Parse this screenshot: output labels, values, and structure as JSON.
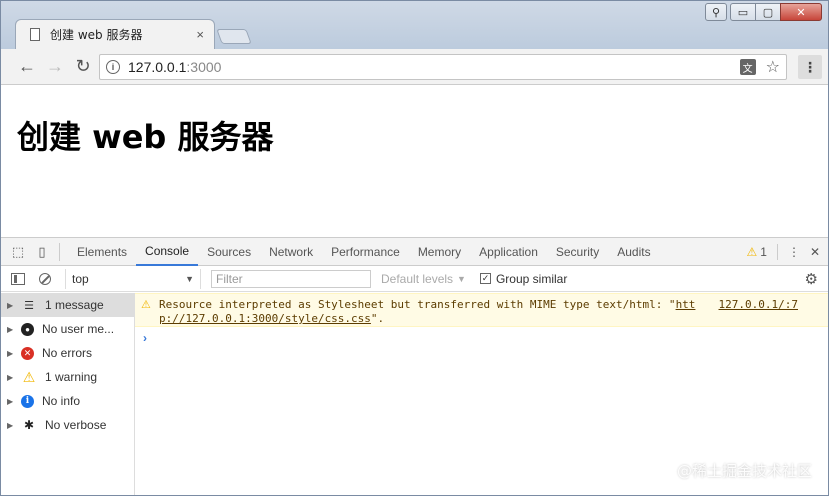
{
  "window": {
    "user_icon": "user-icon",
    "min_label": "▭",
    "max_label": "▢",
    "close_label": "✕"
  },
  "tab": {
    "title": "创建 web 服务器",
    "close_label": "×"
  },
  "toolbar": {
    "back": "←",
    "forward": "→",
    "reload": "↻",
    "url_host": "127.0.0.1",
    "url_port": ":3000",
    "info_label": "i",
    "translate_label": "文",
    "star_label": "☆",
    "menu_label": "⋮"
  },
  "page": {
    "heading": "创建 web 服务器"
  },
  "devtools": {
    "tabs": [
      "Elements",
      "Console",
      "Sources",
      "Network",
      "Performance",
      "Memory",
      "Application",
      "Security",
      "Audits"
    ],
    "active_tab": "Console",
    "warning_count": "1",
    "more_label": "⋮",
    "close_label": "✕",
    "context": "top",
    "filter_placeholder": "Filter",
    "levels_label": "Default levels",
    "levels_arrow": "▼",
    "group_similar_label": "Group similar",
    "group_similar_checked": true,
    "sidebar": [
      {
        "label": "1 message",
        "icon": "list-icon",
        "selected": true
      },
      {
        "label": "No user me...",
        "icon": "user-icon",
        "selected": false
      },
      {
        "label": "No errors",
        "icon": "error-icon",
        "selected": false
      },
      {
        "label": "1 warning",
        "icon": "warning-icon",
        "selected": false
      },
      {
        "label": "No info",
        "icon": "info-icon",
        "selected": false
      },
      {
        "label": "No verbose",
        "icon": "bug-icon",
        "selected": false
      }
    ],
    "messages": [
      {
        "level": "warning",
        "text_before": "Resource interpreted as Stylesheet but transferred with MIME type text/html: \"",
        "link_line1": "htt",
        "link_line2": "p://127.0.0.1:3000/style/css.css",
        "text_after": "\".",
        "source": "127.0.0.1/:7"
      }
    ],
    "prompt": "›"
  },
  "watermark": "@稀土掘金技术社区",
  "colors": {
    "accent": "#3879d9",
    "warning": "#f1b600",
    "error": "#d93025",
    "info": "#1a73e8"
  }
}
